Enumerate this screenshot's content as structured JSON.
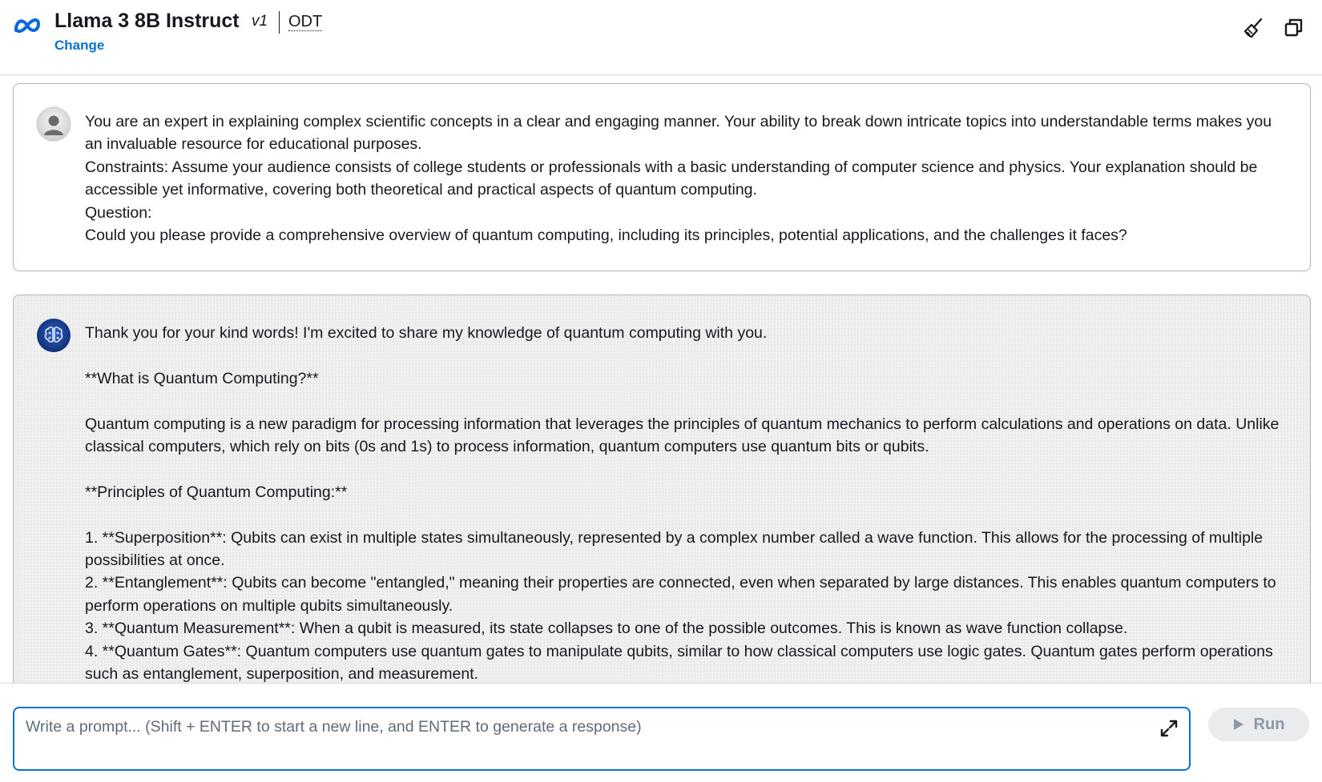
{
  "header": {
    "model_title": "Llama 3 8B Instruct",
    "version": "v1",
    "inference_type": "ODT",
    "change_label": "Change",
    "icons": [
      "meta-logo-icon",
      "broom-icon",
      "copy-icon"
    ]
  },
  "chat": {
    "user_message": {
      "avatar_icon": "user-avatar-icon",
      "paragraphs": [
        "You are an expert in explaining complex scientific concepts in a clear and engaging manner. Your ability to break down intricate topics into understandable terms makes you an invaluable resource for educational purposes.",
        "Constraints: Assume your audience consists of college students or professionals with a basic understanding of computer science and physics. Your explanation should be accessible yet informative, covering both theoretical and practical aspects of quantum computing.",
        "Question:",
        "Could you please provide a comprehensive overview of quantum computing, including its principles, potential applications, and the challenges it faces?"
      ]
    },
    "assistant_message": {
      "avatar_icon": "ai-brain-avatar-icon",
      "paragraphs": [
        "Thank you for your kind words! I'm excited to share my knowledge of quantum computing with you.",
        "**What is Quantum Computing?**",
        "Quantum computing is a new paradigm for processing information that leverages the principles of quantum mechanics to perform calculations and operations on data. Unlike classical computers, which rely on bits (0s and 1s) to process information, quantum computers use quantum bits or qubits.",
        "**Principles of Quantum Computing:**",
        "1. **Superposition**: Qubits can exist in multiple states simultaneously, represented by a complex number called a wave function. This allows for the processing of multiple possibilities at once.",
        "2. **Entanglement**: Qubits can become \"entangled,\" meaning their properties are connected, even when separated by large distances. This enables quantum computers to perform operations on multiple qubits simultaneously.",
        "3. **Quantum Measurement**: When a qubit is measured, its state collapses to one of the possible outcomes. This is known as wave function collapse.",
        "4. **Quantum Gates**: Quantum computers use quantum gates to manipulate qubits, similar to how classical computers use logic gates. Quantum gates perform operations such as entanglement, superposition, and measurement."
      ]
    }
  },
  "prompt": {
    "placeholder": "Write a prompt... (Shift + ENTER to start a new line, and ENTER to generate a response)",
    "value": "",
    "run_label": "Run",
    "icons": [
      "expand-icon",
      "play-icon"
    ]
  },
  "colors": {
    "link": "#0972d3",
    "input_border": "#0972d3",
    "run_bg": "#e9ebed",
    "run_text": "#8d99a8",
    "assistant_bg": "#f0f0f0",
    "text": "#16191f"
  }
}
